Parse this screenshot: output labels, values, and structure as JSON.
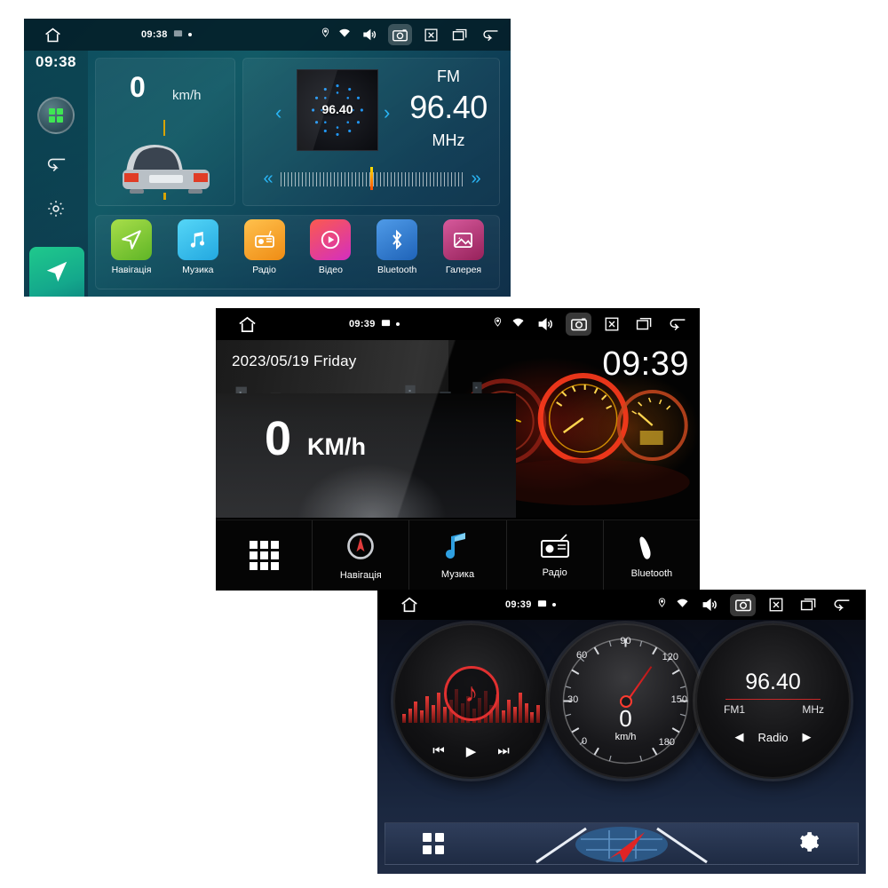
{
  "panel1": {
    "statusbar": {
      "home_icon": "home-icon",
      "clock": "09:38",
      "image_icon": "image-icon",
      "dot": "status-dot",
      "location_icon": "location-pin-icon",
      "wifi_icon": "wifi-icon",
      "volume_icon": "volume-icon",
      "camera_icon": "camera-icon",
      "close_icon": "close-x-icon",
      "recents_icon": "recents-icon",
      "back_icon": "back-arrow-icon"
    },
    "sidebar": {
      "clock": "09:38",
      "apps_icon": "apps-grid-icon",
      "back_icon": "back-arrow-icon",
      "settings_icon": "gear-icon",
      "navigation_icon": "navigation-arrow-icon"
    },
    "speed_widget": {
      "value": "0",
      "unit": "km/h",
      "car_icon": "car-rear-icon"
    },
    "radio_widget": {
      "album_frequency": "96.40",
      "band": "FM",
      "frequency": "96.40",
      "unit": "MHz",
      "prev_arrow": "‹",
      "next_arrow": "›",
      "seek_back": "«",
      "seek_forward": "»"
    },
    "dock": [
      {
        "label": "Навігація",
        "icon": "navigation-arrow-icon",
        "color": "#7cc62e"
      },
      {
        "label": "Музика",
        "icon": "music-note-icon",
        "color": "#35c4ef"
      },
      {
        "label": "Радіо",
        "icon": "radio-icon",
        "color": "#f5a623"
      },
      {
        "label": "Відео",
        "icon": "video-play-icon",
        "color": "#e5399a"
      },
      {
        "label": "Bluetooth",
        "icon": "bluetooth-icon",
        "color": "#2f7fd6"
      },
      {
        "label": "Галерея",
        "icon": "gallery-image-icon",
        "color": "#c2397e"
      }
    ]
  },
  "panel2": {
    "statusbar": {
      "home_icon": "home-icon",
      "clock": "09:39",
      "image_icon": "image-icon",
      "dot": "status-dot",
      "location_icon": "location-pin-icon",
      "wifi_icon": "wifi-icon",
      "volume_icon": "volume-icon",
      "camera_icon": "camera-icon",
      "close_icon": "close-x-icon",
      "recents_icon": "recents-icon",
      "back_icon": "back-arrow-icon"
    },
    "date": "2023/05/19 Friday",
    "clock": "09:39",
    "speed": {
      "value": "0",
      "unit": "KM/h"
    },
    "dock": [
      {
        "label": "",
        "icon": "apps-grid-icon"
      },
      {
        "label": "Навігація",
        "icon": "compass-navigation-icon"
      },
      {
        "label": "Музика",
        "icon": "music-note-icon"
      },
      {
        "label": "Радіо",
        "icon": "radio-icon"
      },
      {
        "label": "Bluetooth",
        "icon": "phone-handset-icon"
      }
    ]
  },
  "panel3": {
    "statusbar": {
      "home_icon": "home-icon",
      "clock": "09:39",
      "image_icon": "image-icon",
      "dot": "status-dot",
      "location_icon": "location-pin-icon",
      "wifi_icon": "wifi-icon",
      "volume_icon": "volume-icon",
      "camera_icon": "camera-icon",
      "close_icon": "close-x-icon",
      "recents_icon": "recents-icon",
      "back_icon": "back-arrow-icon"
    },
    "music_widget": {
      "note_icon": "music-note-icon",
      "prev_label": "⏮",
      "play_label": "▶",
      "next_label": "⏭",
      "accent": "#e03030"
    },
    "speed_widget": {
      "value": "0",
      "unit": "km/h",
      "ticks": [
        "0",
        "30",
        "60",
        "90",
        "120",
        "150",
        "180"
      ],
      "needle_color": "#ff2d2d"
    },
    "radio_widget": {
      "frequency": "96.40",
      "band": "FM1",
      "unit": "MHz",
      "source_label": "Radio",
      "prev_arrow": "◀",
      "next_arrow": "▶"
    },
    "dock": {
      "apps_icon": "apps-grid-icon",
      "map_icon": "navigation-arrow-icon",
      "settings_icon": "gear-icon"
    }
  }
}
